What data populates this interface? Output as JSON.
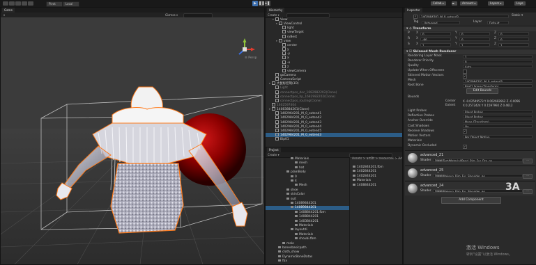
{
  "toolbar": {
    "pivot_label": "Pivot",
    "local_label": "Local",
    "collab_label": "Collab",
    "account_label": "Account",
    "layers_label": "Layers",
    "layout_label": "Layo"
  },
  "scene": {
    "tab": "Game",
    "persp_label": "Persp",
    "gizmos_label": "Gizmos",
    "colors": {
      "sphere": "#8b0000",
      "outline": "#ff7a1a",
      "bg": "#3b3b3b"
    }
  },
  "hierarchy": {
    "tab": "Hierarchy",
    "create_label": "Create",
    "rows": [
      {
        "text": "View",
        "indent": 2,
        "expanded": true
      },
      {
        "text": "ViewControl",
        "indent": 3,
        "expanded": true
      },
      {
        "text": "light",
        "indent": 4
      },
      {
        "text": "viewTarget",
        "indent": 4
      },
      {
        "text": "ryBest",
        "indent": 4
      },
      {
        "text": "view",
        "indent": 3,
        "expanded": true
      },
      {
        "text": "center",
        "indent": 4
      },
      {
        "text": "y",
        "indent": 4
      },
      {
        "text": "-y",
        "indent": 4
      },
      {
        "text": "x",
        "indent": 4
      },
      {
        "text": "-x",
        "indent": 4
      },
      {
        "text": "z",
        "indent": 4
      },
      {
        "text": "viewCamera",
        "indent": 4
      },
      {
        "text": "goCamera",
        "indent": 2
      },
      {
        "text": "CameraScript",
        "indent": 2
      },
      {
        "text": "大鼠标控制(3D)",
        "indent": 1,
        "expanded": true
      },
      {
        "text": "Light",
        "indent": 2,
        "dim": true
      },
      {
        "text": "connectpos_dec_1682982202(Clone)",
        "indent": 2,
        "dim": true
      },
      {
        "text": "connectpos_hp_1682982202(Clone)",
        "indent": 2,
        "dim": true
      },
      {
        "text": "connectpos_routing(Clone)",
        "indent": 2,
        "dim": true
      },
      {
        "text": "1602597404",
        "indent": 1,
        "dim": true
      },
      {
        "text": "14083884201(Clone)",
        "indent": 1,
        "expanded": true
      },
      {
        "text": "1402964201_M_0_extend1",
        "indent": 2
      },
      {
        "text": "1402984201_M_0_extend2",
        "indent": 2
      },
      {
        "text": "1402984201_M_0_extend3",
        "indent": 2
      },
      {
        "text": "1402984201_M_0_extend4",
        "indent": 2
      },
      {
        "text": "1402984201_M_0_extend5",
        "indent": 2
      },
      {
        "text": "1402984201_M_0_extend3",
        "indent": 2,
        "selected": true
      },
      {
        "text": "Bip01",
        "indent": 2
      }
    ]
  },
  "project": {
    "tab": "Project",
    "create_label": "Create",
    "breadcrumb": "Assets > artDt > resources > Art > ...",
    "tree": [
      {
        "text": "Materials",
        "indent": 6
      },
      {
        "text": "mesh",
        "indent": 7
      },
      {
        "text": "hat",
        "indent": 7
      },
      {
        "text": "plainBody",
        "indent": 5
      },
      {
        "text": "0",
        "indent": 6
      },
      {
        "text": "4",
        "indent": 6
      },
      {
        "text": "Mesh",
        "indent": 7
      },
      {
        "text": "shoe",
        "indent": 5
      },
      {
        "text": "skinColor",
        "indent": 5
      },
      {
        "text": "suit",
        "indent": 5
      },
      {
        "text": "14089844201",
        "indent": 6
      },
      {
        "text": "14089844201",
        "indent": 6,
        "selected": true
      },
      {
        "text": "1408844201.fbm",
        "indent": 7
      },
      {
        "text": "1408844201",
        "indent": 7
      },
      {
        "text": "1403844201",
        "indent": 7
      },
      {
        "text": "Materials",
        "indent": 7
      },
      {
        "text": "layoutdi",
        "indent": 6
      },
      {
        "text": "Materials",
        "indent": 7
      },
      {
        "text": "shoubi.fbm",
        "indent": 7
      },
      {
        "text": "male",
        "indent": 4
      },
      {
        "text": "bonesbasicpath",
        "indent": 3
      },
      {
        "text": "cloth_show",
        "indent": 3
      },
      {
        "text": "DynamicBoneDatas",
        "indent": 3
      },
      {
        "text": "fbx",
        "indent": 3
      }
    ],
    "files": [
      "1402844201.fbm",
      "1402844201",
      "1402844201",
      "Materials",
      "1408844201"
    ]
  },
  "inspector": {
    "tab": "Inspector",
    "object_name": "1402984201_M_0_extend3",
    "tag_label": "Tag",
    "tag_value": "Untagged",
    "layer_label": "Layer",
    "layer_value": "Default",
    "transform_title": "Transform",
    "transform_rows": [
      {
        "label": "P",
        "x": "0",
        "y": "0",
        "z": "0"
      },
      {
        "label": "R",
        "x": "-90",
        "y": "0",
        "z": "0"
      },
      {
        "label": "S",
        "x": "1",
        "y": "1",
        "z": "1"
      }
    ],
    "smr_title": "Skinned Mesh Renderer",
    "smr_rows": [
      {
        "label": "Rendering Layer Mask",
        "value": "1"
      },
      {
        "label": "Renderer Priority",
        "value": "0"
      },
      {
        "label": "Quality",
        "value": "Auto"
      },
      {
        "label": "Update When Offscreen",
        "check": ""
      },
      {
        "label": "Skinned Motion Vectors",
        "check": "✓"
      },
      {
        "label": "Mesh",
        "value": "1402984201_M_0_extend3"
      },
      {
        "label": "Root Bone",
        "value": "Bip01 Spine (Transform)"
      }
    ],
    "edit_bounds_label": "Edit Bounds",
    "bounds_label": "Bounds",
    "center_label": "Center",
    "center_value": "X -0.02549573  Y 0.002692662  Z -0.0096",
    "extent_label": "Extent",
    "extent_value": "X 0.2572424  Y 0.1597992  Z 0.4612",
    "extra_rows": [
      {
        "label": "Light Probes",
        "value": "Blend Probes"
      },
      {
        "label": "Reflection Probes",
        "value": "Blend Probes"
      },
      {
        "label": "Anchor Override",
        "value": "None (Transform)"
      },
      {
        "label": "Cast Shadows",
        "value": "On"
      },
      {
        "label": "Receive Shadows",
        "check": "✓"
      },
      {
        "label": "Motion Vectors",
        "value": "Per Object Motion"
      },
      {
        "label": "Materials",
        "value": ""
      },
      {
        "label": "Dynamic Occluded",
        "check": "✓"
      }
    ],
    "materials": [
      {
        "name": "advanced_21",
        "shader_label": "Shader",
        "shader": "DMM/Test/Material/Pearl_Rim_Fur_Dro_go"
      },
      {
        "name": "advanced_25",
        "shader_label": "Shader",
        "shader": "DMM/Makeup_Rim_Fur_Shoulder_go"
      },
      {
        "name": "advanced_24",
        "shader_label": "Shader",
        "shader": "DMM/Makeup_Rim_Fur_Shoulder_go"
      }
    ],
    "add_component_label": "Add Component"
  },
  "watermark": {
    "title": "激活 Windows",
    "subtitle": "转到\"设置\"以激活 Windows。",
    "logo": "3A"
  }
}
